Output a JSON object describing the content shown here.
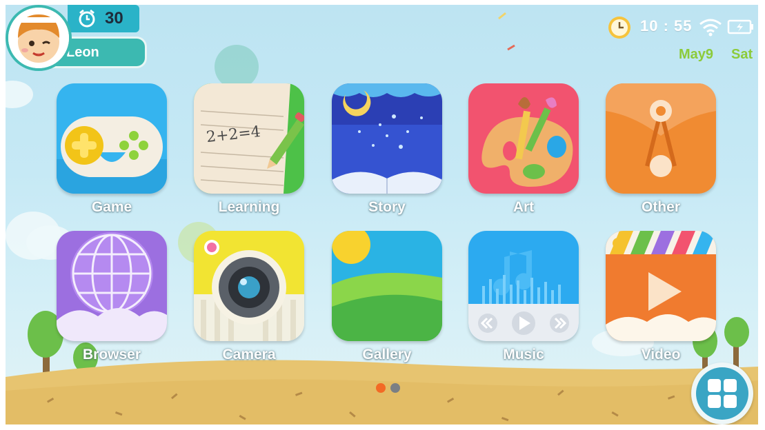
{
  "user": {
    "name": "Leon"
  },
  "timer": {
    "value": "30",
    "icon": "alarm-clock-icon"
  },
  "status": {
    "time": "10 : 55",
    "date": "May9",
    "day": "Sat",
    "icons": [
      "clock-icon",
      "wifi-icon",
      "battery-charging-icon"
    ]
  },
  "apps": [
    {
      "label": "Game"
    },
    {
      "label": "Learning"
    },
    {
      "label": "Story"
    },
    {
      "label": "Art"
    },
    {
      "label": "Other"
    },
    {
      "label": "Browser"
    },
    {
      "label": "Camera"
    },
    {
      "label": "Gallery"
    },
    {
      "label": "Music"
    },
    {
      "label": "Video"
    }
  ],
  "learning_icon_text": "2+2=4",
  "pager": {
    "pages": 2,
    "current": 1
  },
  "colors": {
    "accent": "#3cb9b1",
    "date_green": "#8ccb3a",
    "active_dot": "#f36a25",
    "inactive_dot": "#7b7f84"
  }
}
